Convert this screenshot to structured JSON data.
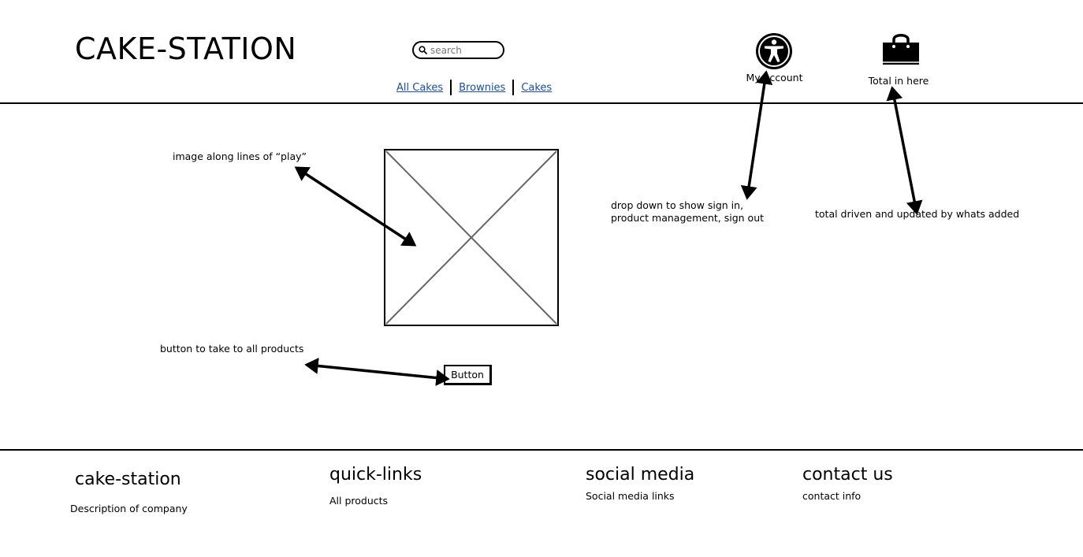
{
  "header": {
    "logo": "CAKE-STATION",
    "search_placeholder": "search",
    "nav": [
      {
        "label": "All Cakes"
      },
      {
        "label": "Brownies"
      },
      {
        "label": "Cakes"
      }
    ],
    "account_label": "My account",
    "cart_label": "Total in here"
  },
  "main": {
    "image_note": "image along lines of “play”",
    "button_note": "button to take to all products",
    "button_label": "Button",
    "account_note": "drop down to show sign in, product management, sign out",
    "cart_note": "total driven and updated by whats added"
  },
  "footer": {
    "col1": {
      "title": "cake-station",
      "text": "Description of company"
    },
    "col2": {
      "title": "quick-links",
      "text": "All products"
    },
    "col3": {
      "title": "social media",
      "text": "Social media links"
    },
    "col4": {
      "title": "contact us",
      "text": "contact info"
    }
  },
  "icons": {
    "search": "search-icon",
    "account": "accessibility-person-icon",
    "cart": "shopping-bag-icon",
    "image": "image-placeholder-icon"
  },
  "colors": {
    "link": "#1f4e8c",
    "ink": "#000000",
    "placeholder_cross": "#666666"
  }
}
